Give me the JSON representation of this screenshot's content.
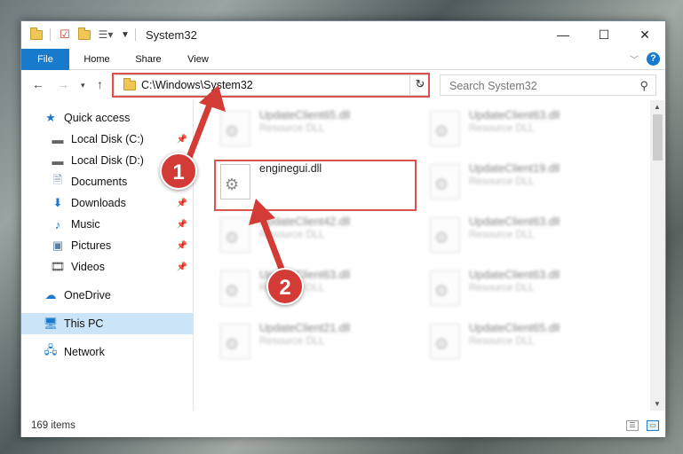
{
  "window": {
    "title": "System32",
    "controls": {
      "minimize": "—",
      "maximize": "☐",
      "close": "✕"
    }
  },
  "ribbon": {
    "tabs": [
      "File",
      "Home",
      "Share",
      "View"
    ],
    "help": "?"
  },
  "navbar": {
    "address": "C:\\Windows\\System32",
    "search_placeholder": "Search System32"
  },
  "sidebar": {
    "items": [
      {
        "label": "Quick access",
        "icon": "star-icon",
        "pinned": false
      },
      {
        "label": "Local Disk (C:)",
        "icon": "drive-icon",
        "pinned": true
      },
      {
        "label": "Local Disk (D:)",
        "icon": "drive-icon",
        "pinned": true
      },
      {
        "label": "Documents",
        "icon": "documents-icon",
        "pinned": true
      },
      {
        "label": "Downloads",
        "icon": "download-icon",
        "pinned": true
      },
      {
        "label": "Music",
        "icon": "music-icon",
        "pinned": true
      },
      {
        "label": "Pictures",
        "icon": "pictures-icon",
        "pinned": true
      },
      {
        "label": "Videos",
        "icon": "videos-icon",
        "pinned": true
      },
      {
        "label": "OneDrive",
        "icon": "cloud-icon",
        "pinned": false
      },
      {
        "label": "This PC",
        "icon": "computer-icon",
        "pinned": false,
        "selected": true
      },
      {
        "label": "Network",
        "icon": "network-icon",
        "pinned": false
      }
    ]
  },
  "files": {
    "col1": [
      {
        "name": "UpdateClient65.dll",
        "type": "Resource DLL"
      },
      {
        "name": "enginegui.dll",
        "type": "",
        "highlighted": true
      },
      {
        "name": "UpdateClient42.dll",
        "type": "Resource DLL"
      },
      {
        "name": "UpdateClient63.dll",
        "type": "Resource DLL"
      },
      {
        "name": "UpdateClient21.dll",
        "type": "Resource DLL"
      }
    ],
    "col2": [
      {
        "name": "UpdateClient63.dll",
        "type": "Resource DLL"
      },
      {
        "name": "UpdateClient19.dll",
        "type": "Resource DLL"
      },
      {
        "name": "UpdateClient63.dll",
        "type": "Resource DLL"
      },
      {
        "name": "UpdateClient63.dll",
        "type": "Resource DLL"
      },
      {
        "name": "UpdateClient65.dll",
        "type": "Resource DLL"
      }
    ]
  },
  "status": {
    "count": "169 items"
  },
  "callouts": [
    "1",
    "2"
  ],
  "colors": {
    "accent": "#1979ca",
    "callout": "#d33b36",
    "highlight_border": "#d9534f"
  }
}
